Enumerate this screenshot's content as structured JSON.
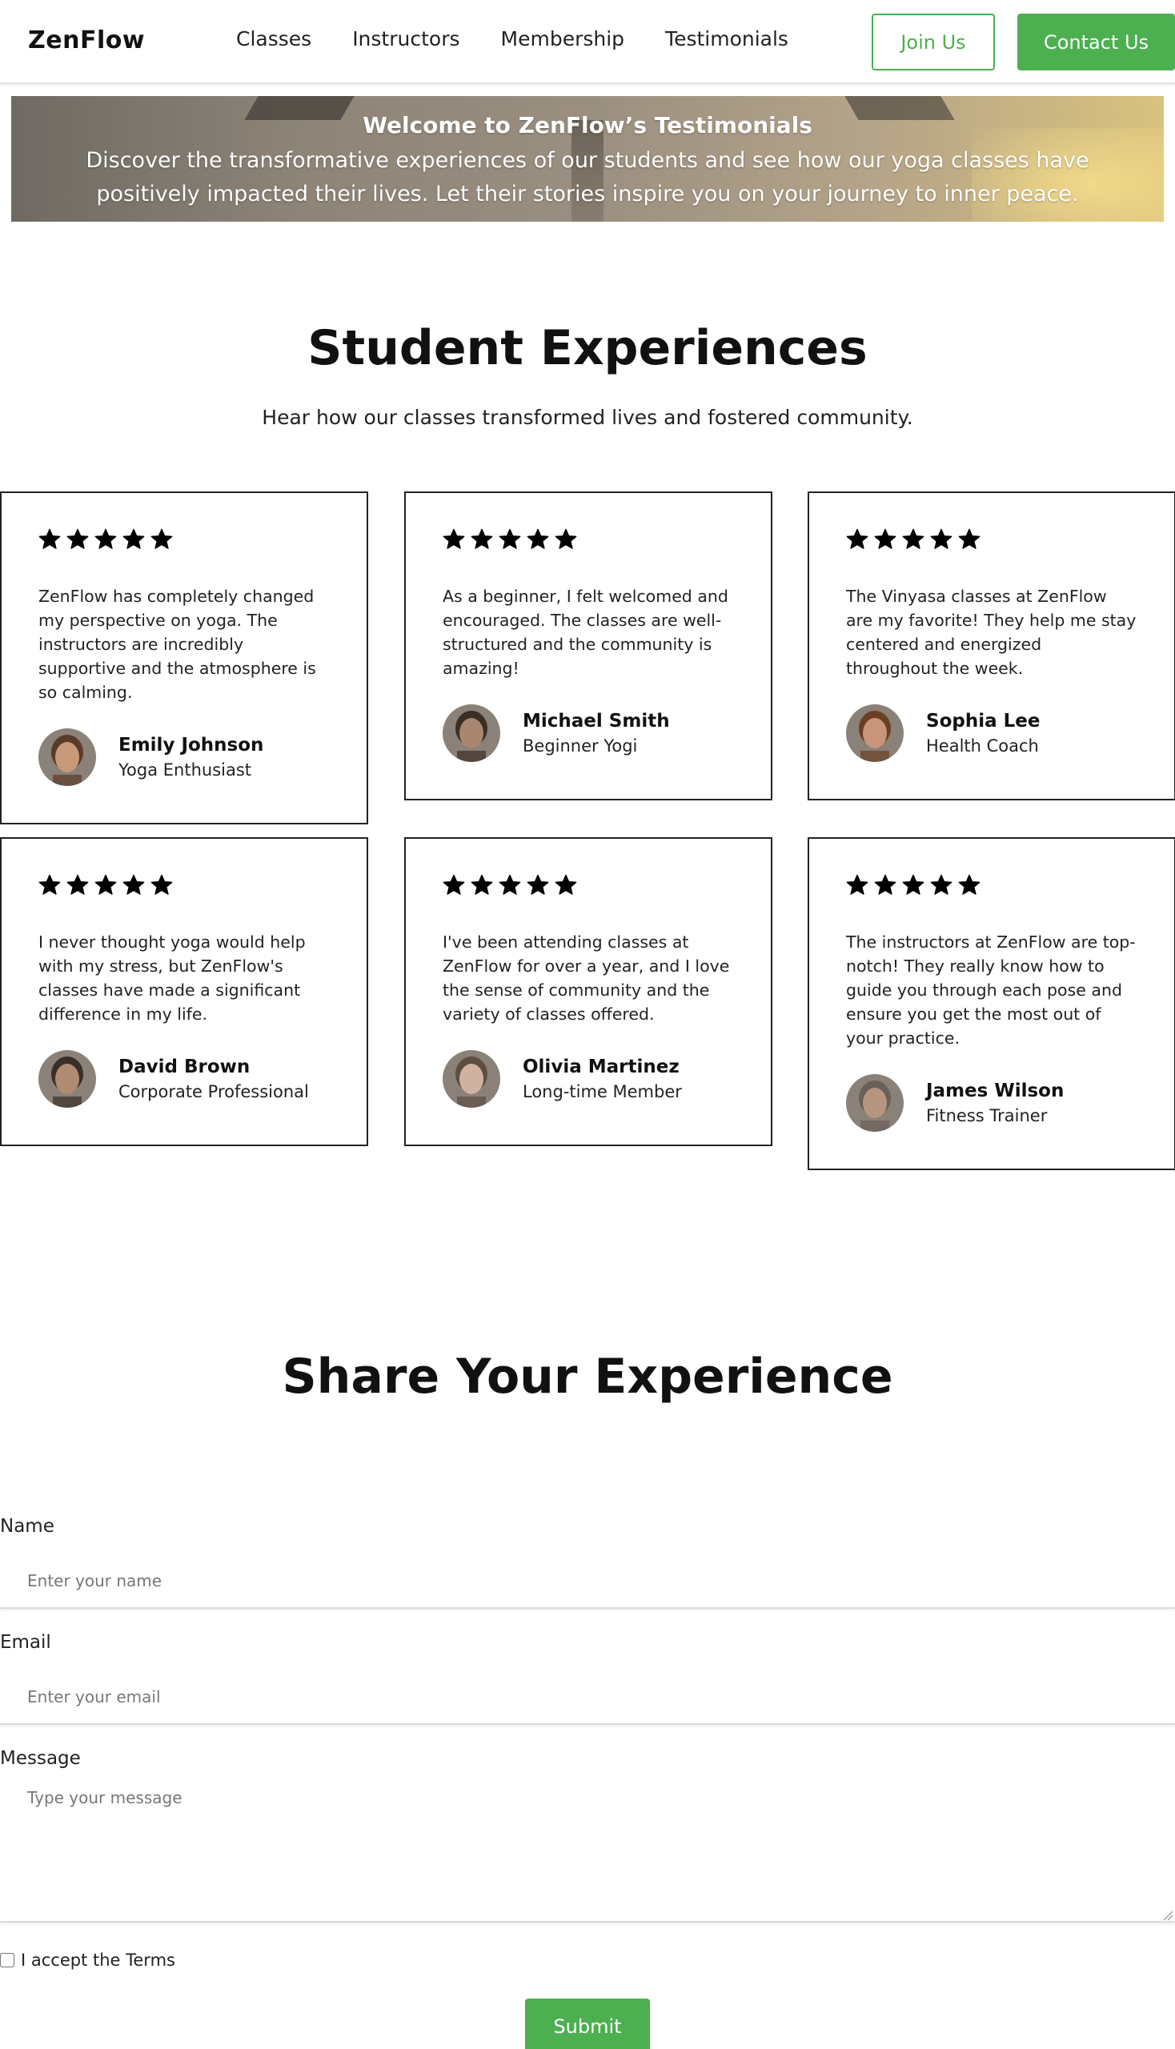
{
  "header": {
    "logo": "ZenFlow",
    "nav": [
      "Classes",
      "Instructors",
      "Membership",
      "Testimonials"
    ],
    "join_label": "Join Us",
    "contact_label": "Contact Us"
  },
  "hero": {
    "title": "Welcome to ZenFlow’s Testimonials",
    "text": "Discover the transformative experiences of our students and see how our yoga classes have positively impacted their lives. Let their stories inspire you on your journey to inner peace."
  },
  "experiences": {
    "title": "Student Experiences",
    "subtitle": "Hear how our classes transformed lives and fostered community.",
    "testimonials": [
      {
        "stars": 5,
        "text": "ZenFlow has completely changed my perspective on yoga. The instructors are incredibly supportive and the atmosphere is so calming.",
        "name": "Emily Johnson",
        "role": "Yoga Enthusiast"
      },
      {
        "stars": 5,
        "text": "As a beginner, I felt welcomed and encouraged. The classes are well-structured and the community is amazing!",
        "name": "Michael Smith",
        "role": "Beginner Yogi"
      },
      {
        "stars": 5,
        "text": "The Vinyasa classes at ZenFlow are my favorite! They help me stay centered and energized throughout the week.",
        "name": "Sophia Lee",
        "role": "Health Coach"
      },
      {
        "stars": 5,
        "text": "I never thought yoga would help with my stress, but ZenFlow's classes have made a significant difference in my life.",
        "name": "David Brown",
        "role": "Corporate Professional"
      },
      {
        "stars": 5,
        "text": "I've been attending classes at ZenFlow for over a year, and I love the sense of community and the variety of classes offered.",
        "name": "Olivia Martinez",
        "role": "Long-time Member"
      },
      {
        "stars": 5,
        "text": "The instructors at ZenFlow are top-notch! They really know how to guide you through each pose and ensure you get the most out of your practice.",
        "name": "James Wilson",
        "role": "Fitness Trainer"
      }
    ]
  },
  "form": {
    "title": "Share Your Experience",
    "name_label": "Name",
    "name_placeholder": "Enter your name",
    "email_label": "Email",
    "email_placeholder": "Enter your email",
    "message_label": "Message",
    "message_placeholder": "Type your message",
    "terms_label": "I accept the Terms",
    "submit_label": "Submit"
  },
  "colors": {
    "accent": "#4caf50",
    "text": "#111111",
    "border": "#222222"
  }
}
